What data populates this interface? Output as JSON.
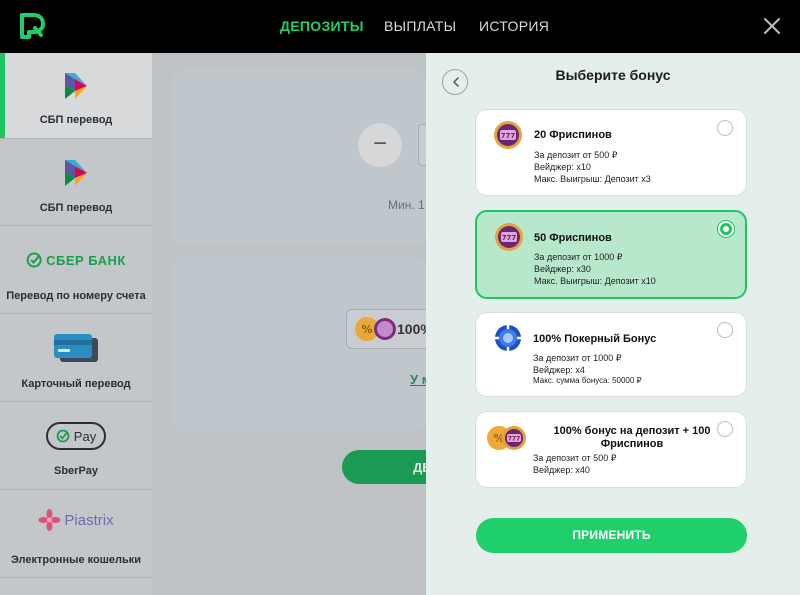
{
  "header": {
    "nav": [
      {
        "label": "ДЕПОЗИТЫ",
        "active": true
      },
      {
        "label": "ВЫПЛАТЫ",
        "active": false
      },
      {
        "label": "ИСТОРИЯ",
        "active": false
      }
    ]
  },
  "sidebar": {
    "items": [
      {
        "label": "СБП перевод",
        "icon": "sbp-icon",
        "active": true
      },
      {
        "label": "СБП перевод",
        "icon": "sbp-icon",
        "active": false
      },
      {
        "label": "Перевод по номеру счета",
        "logo_text": "СБЕР БАНК",
        "icon": "sberbank-logo"
      },
      {
        "label": "Карточный перевод",
        "icon": "card-icon"
      },
      {
        "label": "SberPay",
        "logo_text": "Pay",
        "icon": "sberpay-logo"
      },
      {
        "label": "Электронные кошельки",
        "logo_text": "Piastrix",
        "icon": "piastrix-logo"
      }
    ]
  },
  "background": {
    "minus_label": "−",
    "min_text": "Мин. 1",
    "bonus_pill_text": "100%",
    "link_text": "У м",
    "button_text": "ДЕ"
  },
  "panel": {
    "title": "Выберите бонус",
    "bonuses": [
      {
        "title": "20 Фриспинов",
        "lines": [
          "За депозит  от 500 ₽",
          "Вейджер: x10",
          "Макс. Выигрыш: Депозит x3"
        ],
        "selected": false,
        "icon": "slot-coin-icon"
      },
      {
        "title": "50 Фриспинов",
        "lines": [
          "За депозит  от 1000 ₽",
          "Вейджер: x30",
          "Макс. Выигрыш: Депозит x10"
        ],
        "selected": true,
        "icon": "slot-coin-icon"
      },
      {
        "title": "100% Покерный Бонус",
        "lines": [
          "За депозит  от 1000 ₽",
          "Вейджер: x4",
          "Макс. сумма бонуса: 50000 ₽"
        ],
        "selected": false,
        "icon": "poker-chip-icon"
      },
      {
        "title": "100% бонус на депозит + 100 Фриспинов",
        "title_line1": "100% бонус на депозит + 100",
        "title_line2": "Фриспинов",
        "lines": [
          "За депозит  от 500 ₽",
          "Вейджер: x40"
        ],
        "selected": false,
        "icon": "percent-slot-coins-icon"
      }
    ],
    "apply_label": "ПРИМЕНИТЬ"
  },
  "colors": {
    "accent": "#1fcf6b",
    "header_bg": "#000000",
    "panel_bg": "#e4eeea",
    "selected_card": "#b7e8cc"
  }
}
